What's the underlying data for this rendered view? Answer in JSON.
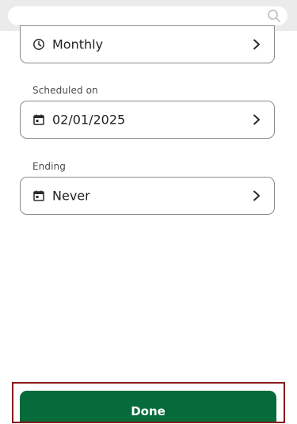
{
  "search": {
    "placeholder": "",
    "icon": "search-icon"
  },
  "frequency": {
    "value": "Monthly",
    "icon": "clock-icon"
  },
  "scheduled": {
    "label": "Scheduled on",
    "value": "02/01/2025",
    "icon": "calendar-icon"
  },
  "ending": {
    "label": "Ending",
    "value": "Never",
    "icon": "calendar-icon"
  },
  "done": {
    "label": "Done"
  },
  "colors": {
    "primary": "#066b3b",
    "highlight_border": "#8b1a1a",
    "top_bar": "#ebebeb"
  }
}
